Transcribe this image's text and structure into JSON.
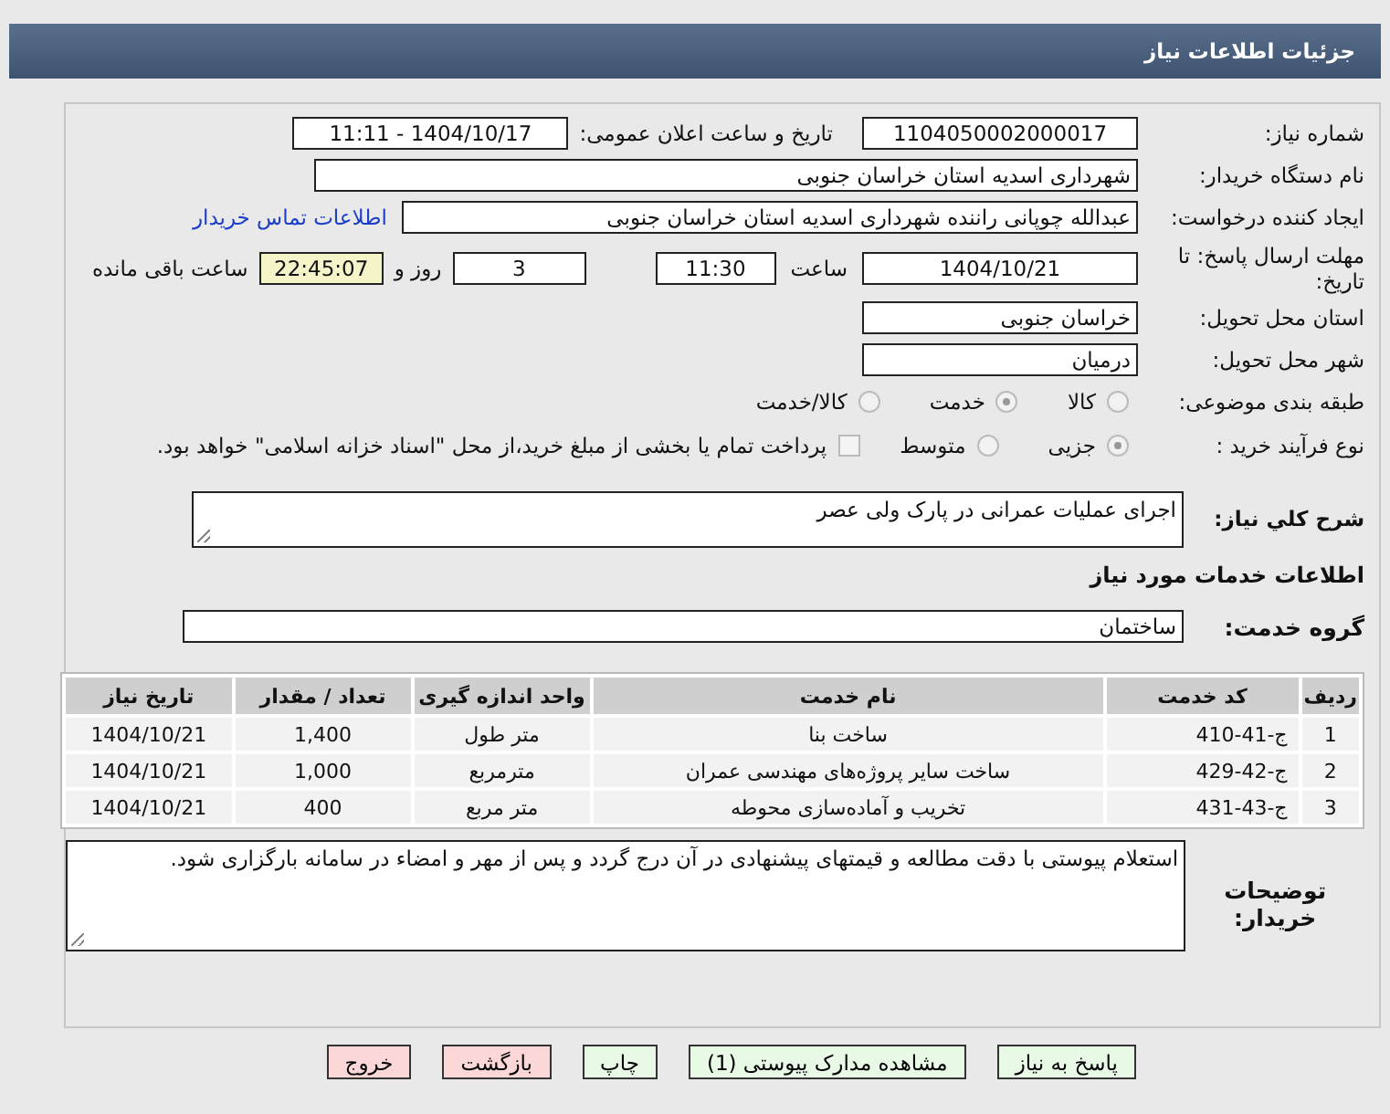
{
  "header": {
    "title": "جزئیات اطلاعات نیاز"
  },
  "need_number": {
    "label": "شماره نیاز:",
    "value": "1104050002000017"
  },
  "announce": {
    "label": "تاریخ و ساعت اعلان عمومی:",
    "value": "1404/10/17 - 11:11"
  },
  "buyer": {
    "label": "نام دستگاه خریدار:",
    "value": "شهرداری اسدیه استان خراسان جنوبی"
  },
  "creator": {
    "label": "ایجاد کننده درخواست:",
    "value": "عبدالله چوپانی راننده شهرداری اسدیه استان خراسان جنوبی",
    "link": "اطلاعات تماس خریدار"
  },
  "deadline": {
    "label": "مهلت ارسال پاسخ: تا تاریخ:",
    "date": "1404/10/21",
    "time_label": "ساعت",
    "time": "11:30",
    "days": "3",
    "days_label": "روز و",
    "remaining": "22:45:07",
    "remaining_label": "ساعت باقی مانده"
  },
  "province": {
    "label": "استان محل تحویل:",
    "value": "خراسان جنوبی"
  },
  "city": {
    "label": "شهر محل تحویل:",
    "value": "درمیان"
  },
  "category": {
    "label": "طبقه بندی موضوعی:",
    "options": [
      {
        "label": "کالا",
        "selected": false
      },
      {
        "label": "خدمت",
        "selected": true
      },
      {
        "label": "کالا/خدمت",
        "selected": false
      }
    ]
  },
  "process": {
    "label": "نوع فرآیند خرید :",
    "options": [
      {
        "label": "جزیی",
        "selected": true
      },
      {
        "label": "متوسط",
        "selected": false
      }
    ],
    "payment": {
      "checked": false,
      "text": "پرداخت تمام یا بخشی از مبلغ خرید،از محل \"اسناد خزانه اسلامی\" خواهد بود."
    }
  },
  "summary": {
    "label": "شرح کلي نياز:",
    "value": "اجرای عملیات عمرانی در پارک ولی عصر"
  },
  "section_title": "اطلاعات خدمات مورد نیاز",
  "service_group": {
    "label": "گروه خدمت:",
    "value": "ساختمان"
  },
  "table": {
    "columns": [
      "ردیف",
      "کد خدمت",
      "نام خدمت",
      "واحد اندازه گیری",
      "تعداد / مقدار",
      "تاریخ نیاز"
    ],
    "rows": [
      [
        "1",
        "ج-41-410",
        "ساخت بنا",
        "متر طول",
        "1,400",
        "1404/10/21"
      ],
      [
        "2",
        "ج-42-429",
        "ساخت سایر پروژه‌های مهندسی عمران",
        "مترمربع",
        "1,000",
        "1404/10/21"
      ],
      [
        "3",
        "ج-43-431",
        "تخریب و آماده‌سازی محوطه",
        "متر مربع",
        "400",
        "1404/10/21"
      ]
    ]
  },
  "notes": {
    "label": "توضیحات خریدار:",
    "value": "استعلام پیوستی با دقت مطالعه و قیمتهای پیشنهادی در آن درج گردد و پس از مهر و امضاء در سامانه بارگزاری شود."
  },
  "buttons": [
    {
      "label": "پاسخ به نیاز",
      "kind": "go"
    },
    {
      "label": "مشاهده مدارک پیوستی (1)",
      "kind": "go"
    },
    {
      "label": "چاپ",
      "kind": "go"
    },
    {
      "label": "بازگشت",
      "kind": "stop"
    },
    {
      "label": "خروج",
      "kind": "stop"
    }
  ]
}
